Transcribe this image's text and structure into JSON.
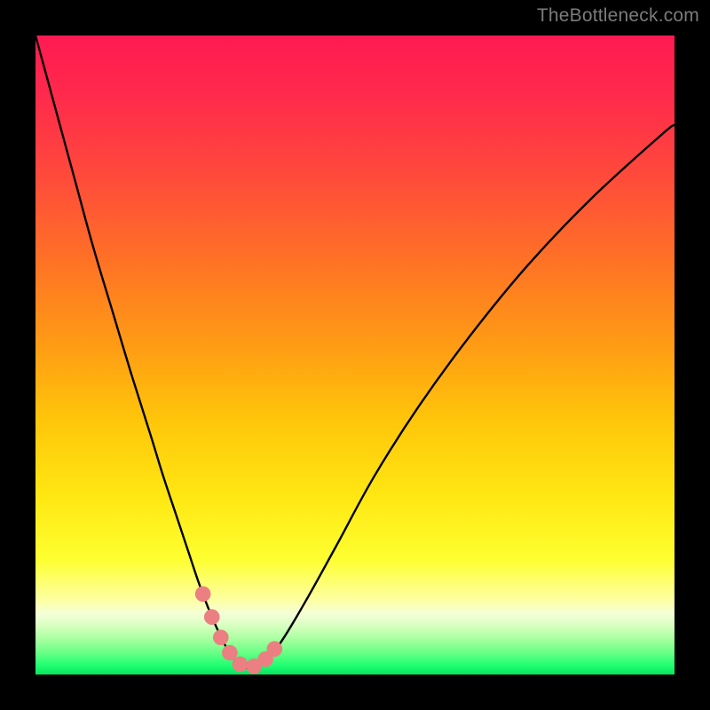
{
  "watermark": "TheBottleneck.com",
  "colors": {
    "bg_black": "#000000",
    "curve": "#000000",
    "marker": "#ec7f81",
    "gradient_stops": [
      {
        "offset": 0.0,
        "color": "#ff1a52"
      },
      {
        "offset": 0.1,
        "color": "#ff2b4b"
      },
      {
        "offset": 0.22,
        "color": "#ff4a3b"
      },
      {
        "offset": 0.35,
        "color": "#ff7126"
      },
      {
        "offset": 0.48,
        "color": "#ff9a15"
      },
      {
        "offset": 0.6,
        "color": "#ffc50a"
      },
      {
        "offset": 0.72,
        "color": "#ffe712"
      },
      {
        "offset": 0.82,
        "color": "#feff30"
      },
      {
        "offset": 0.885,
        "color": "#fdffa6"
      },
      {
        "offset": 0.905,
        "color": "#f4ffd8"
      },
      {
        "offset": 0.925,
        "color": "#d5ffbe"
      },
      {
        "offset": 0.945,
        "color": "#a6ff9f"
      },
      {
        "offset": 0.965,
        "color": "#6cff86"
      },
      {
        "offset": 0.985,
        "color": "#22ff72"
      },
      {
        "offset": 1.0,
        "color": "#04e55e"
      }
    ]
  },
  "chart_data": {
    "type": "line",
    "title": "",
    "xlabel": "",
    "ylabel": "",
    "xlim": [
      0,
      100
    ],
    "ylim": [
      0,
      100
    ],
    "series": [
      {
        "name": "bottleneck-curve",
        "x": [
          0,
          3,
          6,
          9,
          12,
          15,
          18,
          20,
          22,
          24,
          25.5,
          27,
          28.5,
          30,
          31.5,
          33,
          35,
          38,
          42,
          47,
          53,
          60,
          68,
          77,
          87,
          98,
          100
        ],
        "y": [
          100,
          89,
          78,
          67,
          57,
          47,
          37.5,
          31,
          25,
          19,
          14.5,
          10.5,
          7,
          4,
          2,
          1,
          1.5,
          4.5,
          11,
          20,
          31,
          42,
          53,
          64,
          74.5,
          84.5,
          86
        ]
      }
    ],
    "markers": {
      "name": "highlight-points",
      "x": [
        26.2,
        27.6,
        29.0,
        30.4,
        32.0,
        34.2,
        36.0,
        37.4
      ],
      "y": [
        12.6,
        9.0,
        5.8,
        3.4,
        1.6,
        1.3,
        2.4,
        4.0
      ]
    }
  }
}
